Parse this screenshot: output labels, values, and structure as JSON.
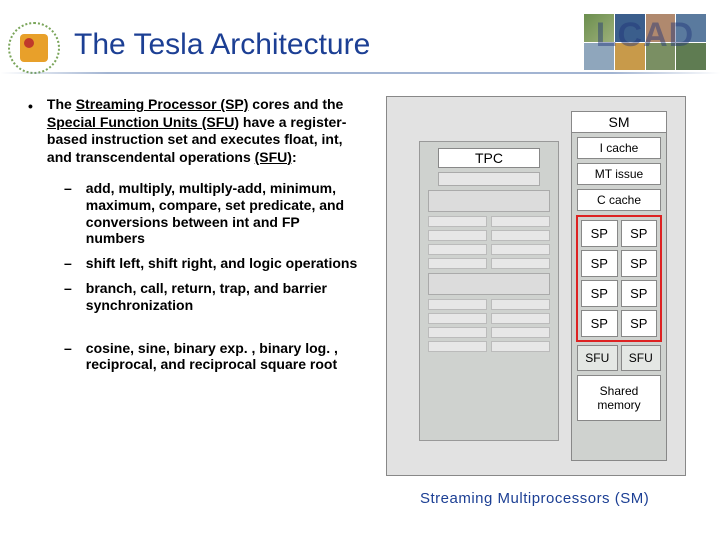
{
  "header": {
    "title": "The Tesla Architecture",
    "logo_text": "LCAD"
  },
  "body": {
    "main_intro_html": "The <span class='u'>Streaming Processor (SP)</span> cores and the <span class='u'>Special Function Units (SFU)</span> have a register-based instruction set and executes float, int, and transcendental operations <span class='u'>(SFU)</span>:",
    "sub_items": [
      "add, multiply, multiply-add, minimum, maximum, compare, set predicate, and conversions between int and FP numbers",
      "shift left, shift right, and logic operations",
      "branch, call, return, trap, and barrier synchronization"
    ],
    "extra_items": [
      "cosine, sine, binary exp. , binary log. , reciprocal, and reciprocal square root"
    ]
  },
  "diagram": {
    "tpc_label": "TPC",
    "sm_label": "SM",
    "rows": {
      "icache": "I cache",
      "mtissue": "MT issue",
      "ccache": "C cache",
      "sp": "SP",
      "sfu": "SFU",
      "shared": "Shared memory"
    },
    "caption": "Streaming  Multiprocessors (SM)"
  }
}
